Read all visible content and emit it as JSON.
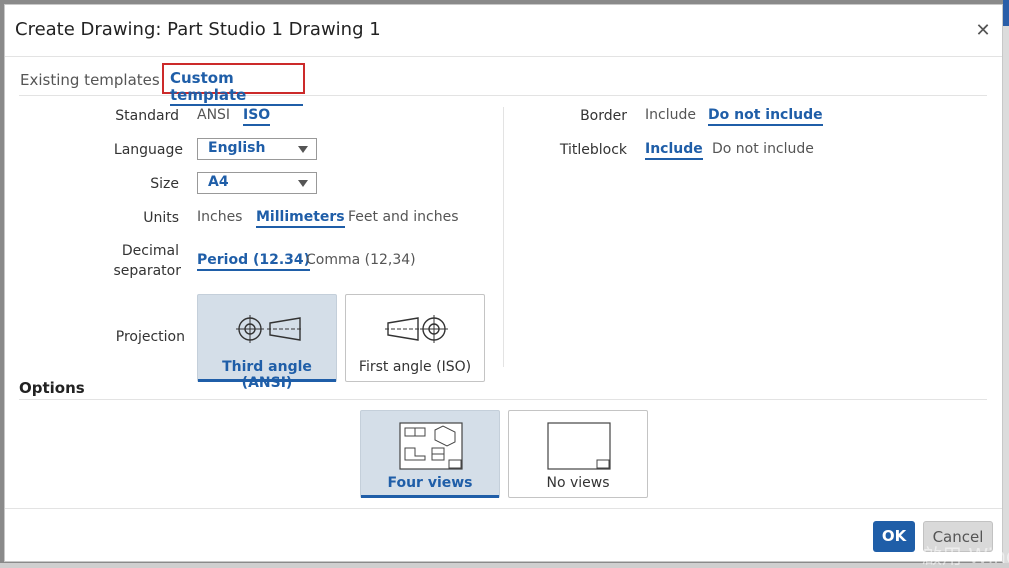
{
  "dialog": {
    "title": "Create Drawing: Part Studio 1 Drawing 1"
  },
  "tabs": {
    "existing": "Existing templates",
    "custom": "Custom template"
  },
  "form": {
    "standard": {
      "label": "Standard",
      "options": [
        "ANSI",
        "ISO"
      ],
      "selected": "ISO"
    },
    "language": {
      "label": "Language",
      "value": "English"
    },
    "size": {
      "label": "Size",
      "value": "A4"
    },
    "units": {
      "label": "Units",
      "options": [
        "Inches",
        "Millimeters",
        "Feet and inches"
      ],
      "selected": "Millimeters"
    },
    "decimal": {
      "label_line1": "Decimal",
      "label_line2": "separator",
      "options": [
        "Period (12.34)",
        "Comma (12,34)"
      ],
      "selected": "Period (12.34)"
    },
    "projection": {
      "label": "Projection",
      "options": [
        "Third angle (ANSI)",
        "First angle (ISO)"
      ],
      "selected": "Third angle (ANSI)"
    },
    "border": {
      "label": "Border",
      "options": [
        "Include",
        "Do not include"
      ],
      "selected": "Do not include"
    },
    "titleblock": {
      "label": "Titleblock",
      "options": [
        "Include",
        "Do not include"
      ],
      "selected": "Include"
    }
  },
  "options": {
    "heading": "Options",
    "views": [
      "Four views",
      "No views"
    ],
    "selected": "Four views"
  },
  "buttons": {
    "ok": "OK",
    "cancel": "Cancel"
  },
  "watermark": "啟用 Windows",
  "colors": {
    "accent": "#1f5ea8",
    "highlight_frame": "#cc2a2a",
    "selected_card_bg": "#d4dee8"
  }
}
